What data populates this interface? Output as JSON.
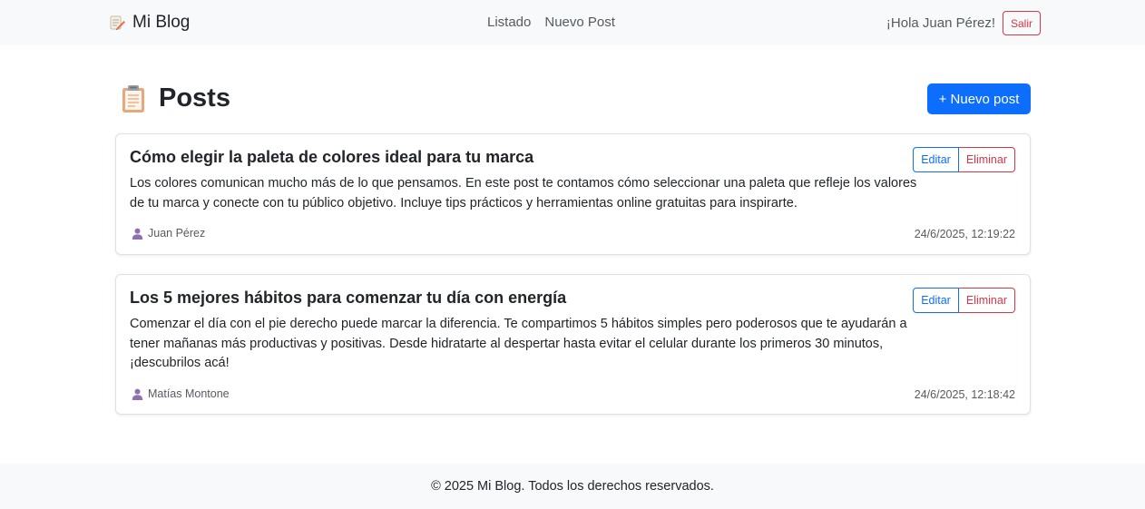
{
  "navbar": {
    "brand_icon": "memo-pencil-icon",
    "brand": "Mi Blog",
    "links": [
      "Listado",
      "Nuevo Post"
    ],
    "greeting": "¡Hola Juan Pérez!",
    "logout_label": "Salir"
  },
  "page": {
    "title_icon": "clipboard-icon",
    "title": "Posts",
    "new_post_label": "+ Nuevo post"
  },
  "posts": [
    {
      "title": "Cómo elegir la paleta de colores ideal para tu marca",
      "excerpt": "Los colores comunican mucho más de lo que pensamos. En este post te contamos cómo seleccionar una paleta que refleje los valores de tu marca y conecte con tu público objetivo. Incluye tips prácticos y herramientas online gratuitas para inspirarte.",
      "author": "Juan Pérez",
      "date": "24/6/2025, 12:19:22",
      "edit_label": "Editar",
      "delete_label": "Eliminar"
    },
    {
      "title": "Los 5 mejores hábitos para comenzar tu día con energía",
      "excerpt": "Comenzar el día con el pie derecho puede marcar la diferencia. Te compartimos 5 hábitos simples pero poderosos que te ayudarán a tener mañanas más productivas y positivas. Desde hidratarte al despertar hasta evitar el celular durante los primeros 30 minutos, ¡descubrilos acá!",
      "author": "Matías Montone",
      "date": "24/6/2025, 12:18:42",
      "edit_label": "Editar",
      "delete_label": "Eliminar"
    }
  ],
  "footer": {
    "text": "© 2025 Mi Blog. Todos los derechos reservados."
  },
  "colors": {
    "primary": "#0d6efd",
    "danger": "#dc3545",
    "navbar_bg": "#f8f9fa",
    "user_icon": "#8e6fb0"
  }
}
